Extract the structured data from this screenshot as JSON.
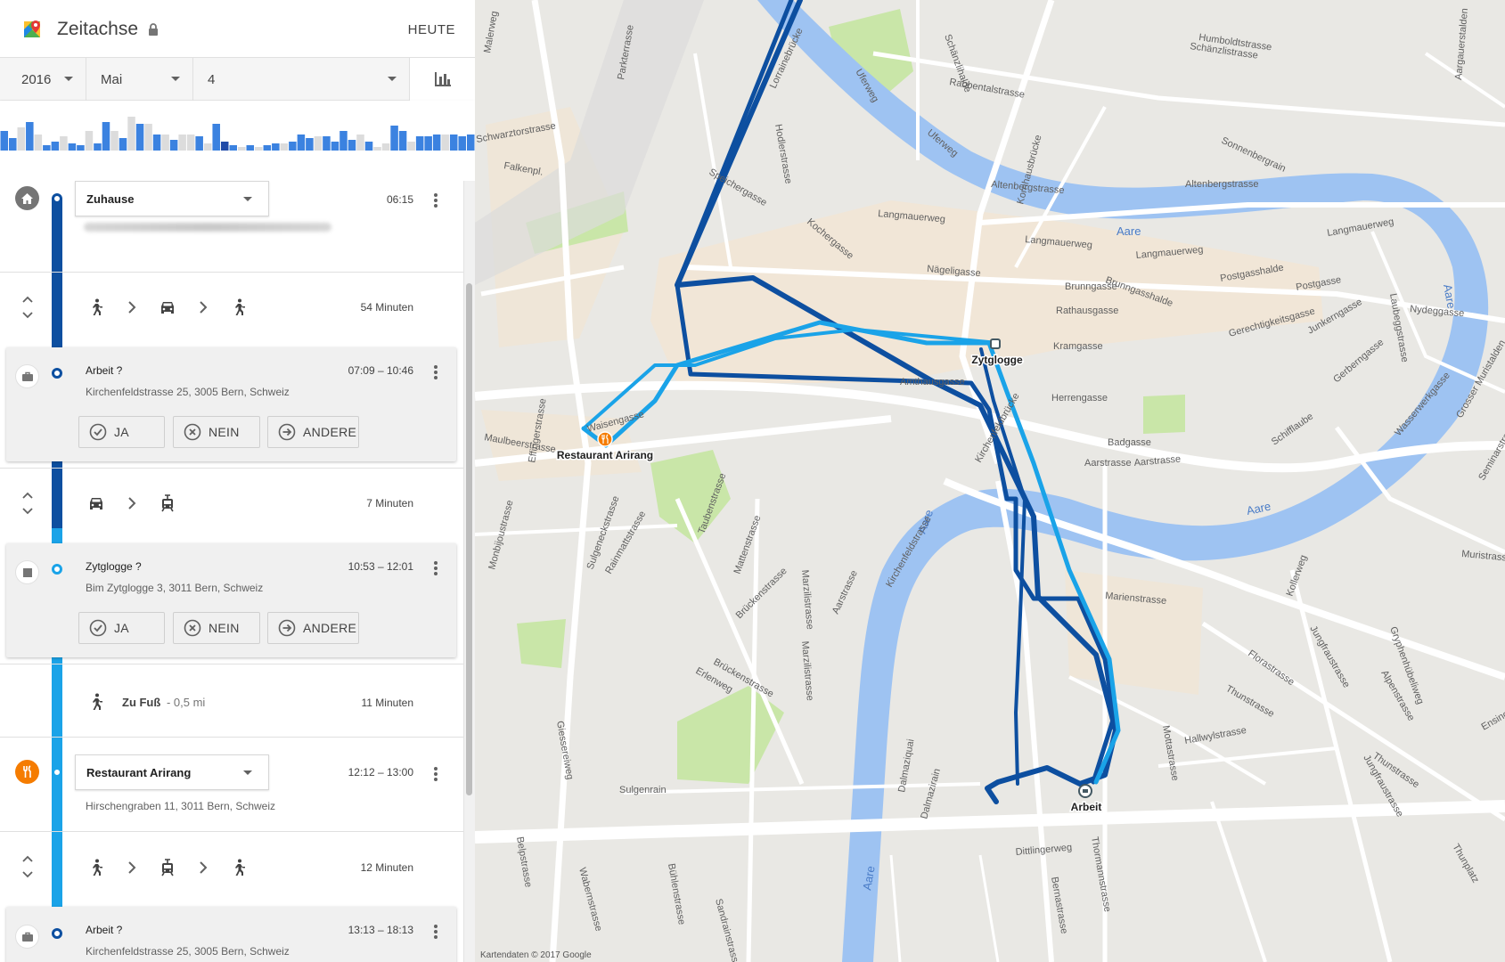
{
  "app": {
    "title": "Zeitachse",
    "today_label": "HEUTE",
    "icons": {
      "logo": "google-maps-icon",
      "lock": "lock-icon",
      "chart": "bar-chart-icon"
    }
  },
  "date": {
    "year": "2016",
    "month": "Mai",
    "day": "4"
  },
  "histogram": {
    "colors": {
      "blue": "#3b82e0",
      "grey": "#dcdcdc",
      "dark": "#1f4aa8"
    },
    "bars": [
      {
        "v": 0.55,
        "c": "blue"
      },
      {
        "v": 0.35,
        "c": "blue"
      },
      {
        "v": 0.65,
        "c": "grey"
      },
      {
        "v": 0.8,
        "c": "blue"
      },
      {
        "v": 0.45,
        "c": "grey"
      },
      {
        "v": 0.15,
        "c": "blue"
      },
      {
        "v": 0.25,
        "c": "blue"
      },
      {
        "v": 0.4,
        "c": "grey"
      },
      {
        "v": 0.2,
        "c": "blue"
      },
      {
        "v": 0.15,
        "c": "blue"
      },
      {
        "v": 0.55,
        "c": "grey"
      },
      {
        "v": 0.2,
        "c": "blue"
      },
      {
        "v": 0.8,
        "c": "blue"
      },
      {
        "v": 0.55,
        "c": "grey"
      },
      {
        "v": 0.35,
        "c": "blue"
      },
      {
        "v": 0.95,
        "c": "grey"
      },
      {
        "v": 0.75,
        "c": "blue"
      },
      {
        "v": 0.75,
        "c": "grey"
      },
      {
        "v": 0.45,
        "c": "blue"
      },
      {
        "v": 0.45,
        "c": "grey"
      },
      {
        "v": 0.3,
        "c": "blue"
      },
      {
        "v": 0.45,
        "c": "grey"
      },
      {
        "v": 0.45,
        "c": "grey"
      },
      {
        "v": 0.4,
        "c": "blue"
      },
      {
        "v": 0.2,
        "c": "grey"
      },
      {
        "v": 0.75,
        "c": "blue"
      },
      {
        "v": 0.25,
        "c": "dark"
      },
      {
        "v": 0.15,
        "c": "blue"
      },
      {
        "v": 0.1,
        "c": "grey"
      },
      {
        "v": 0.15,
        "c": "blue"
      },
      {
        "v": 0.1,
        "c": "grey"
      },
      {
        "v": 0.15,
        "c": "blue"
      },
      {
        "v": 0.2,
        "c": "blue"
      },
      {
        "v": 0.2,
        "c": "grey"
      },
      {
        "v": 0.25,
        "c": "blue"
      },
      {
        "v": 0.45,
        "c": "blue"
      },
      {
        "v": 0.35,
        "c": "blue"
      },
      {
        "v": 0.4,
        "c": "grey"
      },
      {
        "v": 0.4,
        "c": "blue"
      },
      {
        "v": 0.25,
        "c": "blue"
      },
      {
        "v": 0.55,
        "c": "blue"
      },
      {
        "v": 0.3,
        "c": "blue"
      },
      {
        "v": 0.45,
        "c": "grey"
      },
      {
        "v": 0.25,
        "c": "blue"
      },
      {
        "v": 0.1,
        "c": "grey"
      },
      {
        "v": 0.2,
        "c": "grey"
      },
      {
        "v": 0.7,
        "c": "blue"
      },
      {
        "v": 0.55,
        "c": "blue"
      },
      {
        "v": 0.25,
        "c": "grey"
      },
      {
        "v": 0.4,
        "c": "blue"
      },
      {
        "v": 0.4,
        "c": "blue"
      },
      {
        "v": 0.45,
        "c": "blue"
      },
      {
        "v": 0.45,
        "c": "grey"
      },
      {
        "v": 0.45,
        "c": "blue"
      },
      {
        "v": 0.4,
        "c": "blue"
      },
      {
        "v": 0.45,
        "c": "blue"
      }
    ]
  },
  "timeline": {
    "colors": {
      "dark_line": "#0d4fa0",
      "light_line": "#1aa3e8"
    },
    "home": {
      "name": "Zuhause",
      "time": "06:15",
      "icon": "home-icon"
    },
    "move1": {
      "modes": [
        "walk-icon",
        "car-icon",
        "walk-icon"
      ],
      "duration": "54 Minuten"
    },
    "visit1": {
      "title": "Arbeit ?",
      "address": "Kirchenfeldstrasse 25, 3005 Bern, Schweiz",
      "time": "07:09 – 10:46",
      "icon": "briefcase-icon"
    },
    "move2": {
      "modes": [
        "car-icon",
        "tram-icon"
      ],
      "duration": "7 Minuten"
    },
    "visit2": {
      "title": "Zytglogge ?",
      "address": "Bim Zytglogge 3, 3011 Bern, Schweiz",
      "time": "10:53 – 12:01",
      "icon": "stop-square-icon"
    },
    "move3": {
      "mode": "walk-icon",
      "label": "Zu Fuß",
      "distance": "- 0,5 mi",
      "duration": "11 Minuten"
    },
    "visit3": {
      "name": "Restaurant Arirang",
      "address": "Hirschengraben 11, 3011 Bern, Schweiz",
      "time": "12:12 – 13:00",
      "icon": "fork-knife-icon"
    },
    "move4": {
      "modes": [
        "walk-icon",
        "tram-icon",
        "walk-icon"
      ],
      "duration": "12 Minuten"
    },
    "visit4": {
      "title": "Arbeit ?",
      "address": "Kirchenfeldstrasse 25, 3005 Bern, Schweiz",
      "time": "13:13 – 18:13",
      "icon": "briefcase-icon"
    },
    "buttons": {
      "yes": "JA",
      "no": "NEIN",
      "other": "ANDERE"
    }
  },
  "map": {
    "copyright": "Kartendaten © 2017 Google",
    "colors": {
      "water": "#9ec3f2",
      "park": "#c9e6a8",
      "road": "#ffffff",
      "old_town": "#f1e6d7",
      "route_dark": "#0d4fa0",
      "route_light": "#1aa3e8",
      "marker_orange": "#f57c00"
    },
    "markers": [
      "Zytglogge",
      "Restaurant Arirang",
      "Arbeit"
    ],
    "water_labels": [
      "Aare",
      "Aare",
      "Aare",
      "Aare",
      "Aare"
    ],
    "street_labels": [
      "Parkterrasse",
      "Malerweg",
      "Lorrainebrücke",
      "Hodlerstrasse",
      "Uferweg",
      "Schänzlihalde",
      "Rabbentalstrasse",
      "Humboldtstrasse",
      "Schänzlistrasse",
      "Sonnenbergrain",
      "Altenbergstrasse",
      "Altenbergstrasse",
      "Kornhausbrücke",
      "Uferweg",
      "Falkenpl.",
      "Speichergasse",
      "Langmauerweg",
      "Langmauerweg",
      "Langmauerweg",
      "Langmauerweg",
      "Nägeligasse",
      "Brunngasshalde",
      "Brunngasse",
      "Postgasshalde",
      "Postgasse",
      "Rathausgasse",
      "Nydeggasse",
      "Gerechtigkeitsgasse",
      "Junkerngasse",
      "Kramgasse",
      "Herrengasse",
      "Amthausgasse",
      "Gerberngasse",
      "Wasserwerkgasse",
      "Schifflaube",
      "Badgasse",
      "Aarstrasse",
      "Aarstrasse",
      "Maulbeerstrasse",
      "Waisengasse",
      "Sulgeneckstrasse",
      "Taubenstrasse",
      "Monbijoustrasse",
      "Rainmattstrasse",
      "Marzilistrasse",
      "Aarstrasse",
      "Brückenstrasse",
      "Mattenstrasse",
      "Marienstrasse",
      "Florastrasse",
      "Thunstrasse",
      "Alpenstrasse",
      "Jungfraustrasse",
      "Kollerweg",
      "Muristrasse",
      "Erlenweg",
      "Dalmaziquai",
      "Dalmazirain",
      "Mottastrasse",
      "Hallwylstrasse",
      "Thunstrasse",
      "Gryphenhübeliweg",
      "Sulgenrain",
      "Dittlingerweg",
      "Thormannstrasse",
      "Bernastrasse",
      "Sandrainstrasse",
      "Bühlenstrasse",
      "Wabernstrasse",
      "Giessereiweg",
      "Kirchenfeldbrücke",
      "Marzilistrasse",
      "Brückenstrasse",
      "Aargauerstalden",
      "Laubeggstrasse",
      "Jungfraustrasse",
      "Ensingerstrasse",
      "Seminarstrasse",
      "Grosser Muristalden",
      "Kirchenfeldstrasse",
      "Belpstrasse",
      "Effingerstrasse",
      "Schwarztorstrasse",
      "Thunplatz",
      "Kochergasse"
    ]
  }
}
